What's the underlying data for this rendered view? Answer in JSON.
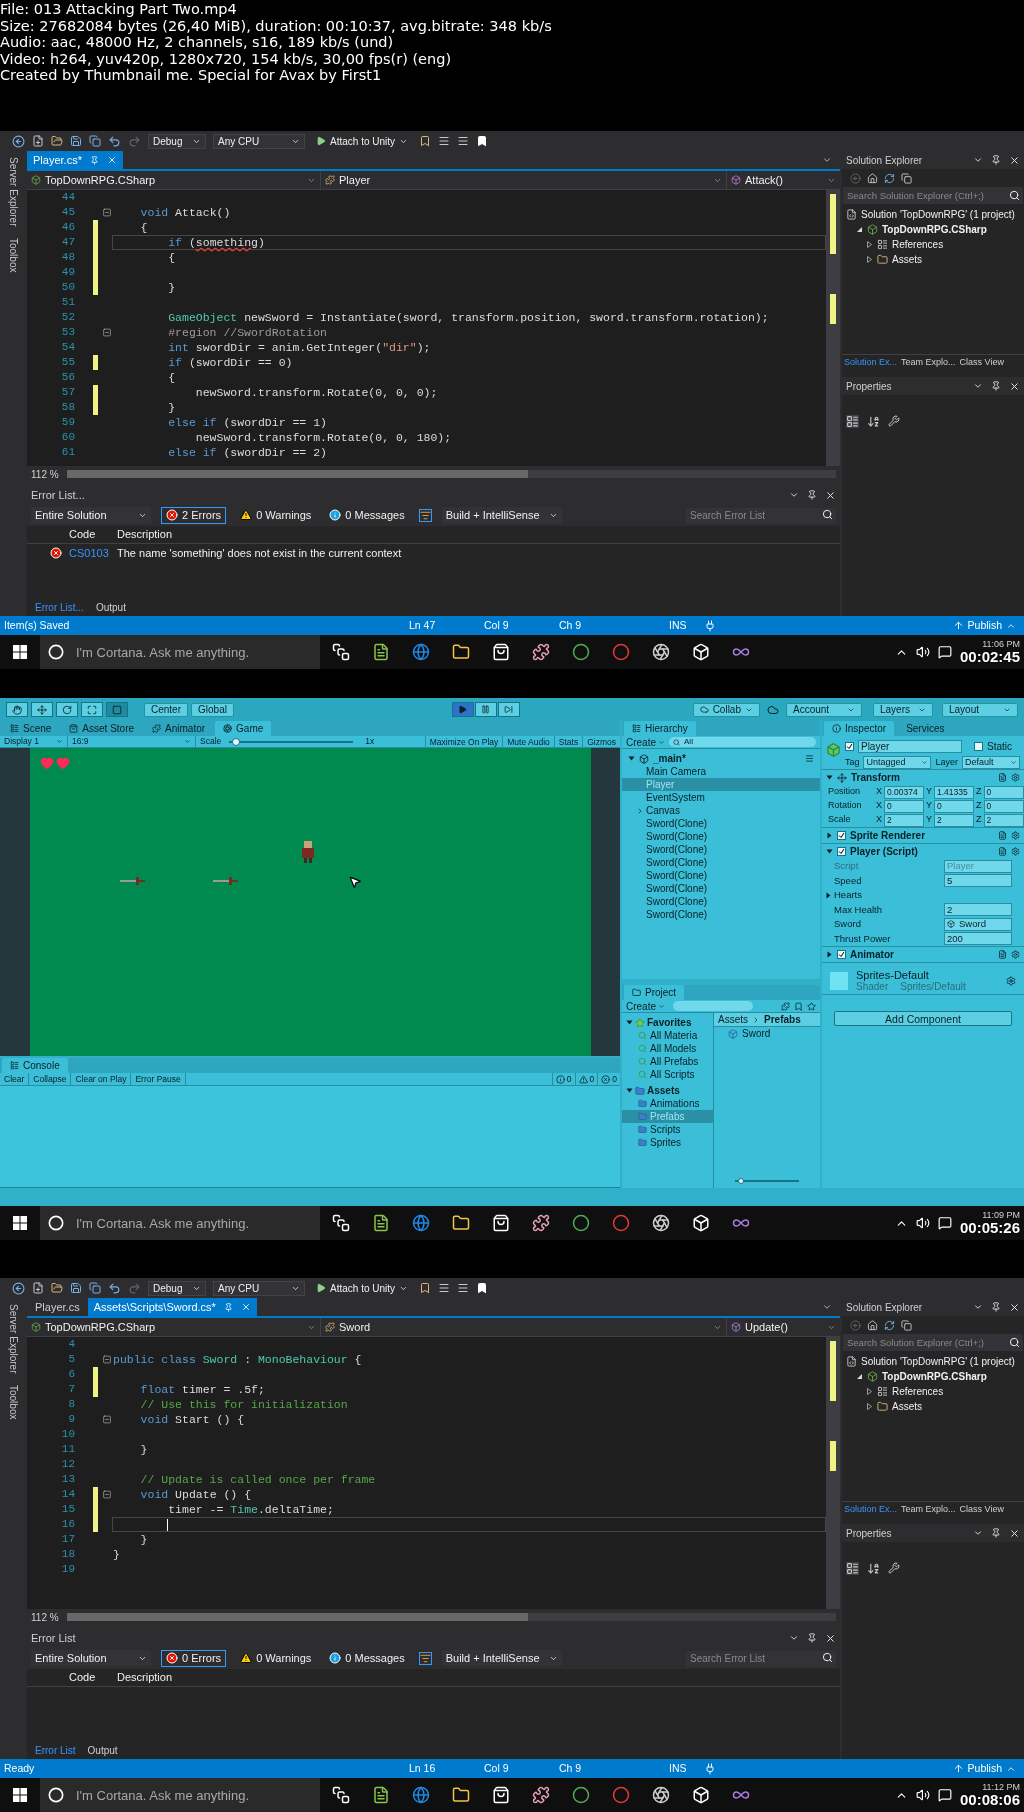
{
  "file_info": [
    "File: 013 Attacking Part Two.mp4",
    "Size: 27682084 bytes (26,40 MiB), duration: 00:10:37, avg.bitrate: 348 kb/s",
    "Audio: aac, 48000 Hz, 2 channels, s16, 189 kb/s (und)",
    "Video: h264, yuv420p, 1280x720, 154 kb/s, 30,00 fps(r) (eng)",
    "Created by Thumbnail me. Special for Avax by First1"
  ],
  "frames": [
    {
      "kind": "visual_studio",
      "toolbar": {
        "configuration": "Debug",
        "platform": "Any CPU",
        "run": "Attach to Unity"
      },
      "side_tabs": [
        "Server Explorer",
        "Toolbox"
      ],
      "tabs": [
        {
          "label": "Player.cs*",
          "selected": true
        }
      ],
      "navigation": [
        "TopDownRPG.CSharp",
        "Player",
        "Attack()"
      ],
      "lines": [
        {
          "number": "44",
          "changed": false,
          "current": false,
          "foldable": false
        },
        {
          "number": "45",
          "changed": false,
          "current": false,
          "foldable": true,
          "parts": [
            {
              "text": "    void",
              "kind": "keyword"
            },
            {
              "text": " Attack()",
              "kind": "plain"
            }
          ]
        },
        {
          "number": "46",
          "changed": true,
          "current": false,
          "foldable": false,
          "parts": [
            {
              "text": "    {",
              "kind": "plain"
            }
          ]
        },
        {
          "number": "47",
          "changed": true,
          "current": true,
          "foldable": false,
          "parts": [
            {
              "text": "        if",
              "kind": "keyword"
            },
            {
              "text": " (",
              "kind": "plain"
            },
            {
              "text": "something",
              "kind": "error"
            },
            {
              "text": ")",
              "kind": "plain"
            }
          ]
        },
        {
          "number": "48",
          "changed": true,
          "current": false,
          "foldable": false,
          "parts": [
            {
              "text": "        {",
              "kind": "plain"
            }
          ]
        },
        {
          "number": "49",
          "changed": true,
          "current": false,
          "foldable": false
        },
        {
          "number": "50",
          "changed": true,
          "current": false,
          "foldable": false,
          "parts": [
            {
              "text": "        }",
              "kind": "plain"
            }
          ]
        },
        {
          "number": "51",
          "changed": false,
          "current": false,
          "foldable": false
        },
        {
          "number": "52",
          "changed": false,
          "current": false,
          "foldable": false,
          "parts": [
            {
              "text": "        GameObject",
              "kind": "type"
            },
            {
              "text": " newSword = Instantiate(sword, transform.position, sword.transform.rotation);",
              "kind": "plain"
            }
          ]
        },
        {
          "number": "53",
          "changed": false,
          "current": false,
          "foldable": true,
          "parts": [
            {
              "text": "        #region //SwordRotation",
              "kind": "preprocessor"
            }
          ]
        },
        {
          "number": "54",
          "changed": false,
          "current": false,
          "foldable": false,
          "parts": [
            {
              "text": "        int",
              "kind": "keyword"
            },
            {
              "text": " swordDir = anim.GetInteger(",
              "kind": "plain"
            },
            {
              "text": "\"dir\"",
              "kind": "string"
            },
            {
              "text": ");",
              "kind": "plain"
            }
          ]
        },
        {
          "number": "55",
          "changed": true,
          "current": false,
          "foldable": false,
          "parts": [
            {
              "text": "        if",
              "kind": "keyword"
            },
            {
              "text": " (swordDir == 0)",
              "kind": "plain"
            }
          ]
        },
        {
          "number": "56",
          "changed": false,
          "current": false,
          "foldable": false,
          "parts": [
            {
              "text": "        {",
              "kind": "plain"
            }
          ]
        },
        {
          "number": "57",
          "changed": true,
          "current": false,
          "foldable": false,
          "parts": [
            {
              "text": "            newSword.transform.Rotate(0, 0, 0);",
              "kind": "plain"
            }
          ]
        },
        {
          "number": "58",
          "changed": true,
          "current": false,
          "foldable": false,
          "parts": [
            {
              "text": "        }",
              "kind": "plain"
            }
          ]
        },
        {
          "number": "59",
          "changed": false,
          "current": false,
          "foldable": false,
          "parts": [
            {
              "text": "        else if",
              "kind": "keyword"
            },
            {
              "text": " (swordDir == 1)",
              "kind": "plain"
            }
          ]
        },
        {
          "number": "60",
          "changed": false,
          "current": false,
          "foldable": false,
          "parts": [
            {
              "text": "            newSword.transform.Rotate(0, 0, 180);",
              "kind": "plain"
            }
          ]
        },
        {
          "number": "61",
          "changed": false,
          "current": false,
          "foldable": false,
          "parts": [
            {
              "text": "        else if",
              "kind": "keyword"
            },
            {
              "text": " (swordDir == 2)",
              "kind": "plain"
            }
          ]
        }
      ],
      "zoom": "112 %",
      "error_list": {
        "title": "Error List...",
        "scope": "Entire Solution",
        "errors": "2 Errors",
        "warnings": "0 Warnings",
        "messages": "0 Messages",
        "filter": "Build + IntelliSense",
        "search_placeholder": "Search Error List",
        "columns": [
          "Code",
          "Description"
        ],
        "rows": [
          {
            "code": "CS0103",
            "description": "The name 'something' does not exist in the current context"
          }
        ],
        "tabs": [
          {
            "label": "Error List...",
            "selected": true
          },
          {
            "label": "Output",
            "selected": false
          }
        ]
      },
      "solution_explorer": {
        "title": "Solution Explorer",
        "search_placeholder": "Search Solution Explorer (Ctrl+;)",
        "tree": [
          {
            "label": "Solution 'TopDownRPG' (1 project)",
            "kind": "solution",
            "children": [
              {
                "label": "TopDownRPG.CSharp",
                "kind": "project",
                "expanded": true,
                "children": [
                  {
                    "label": "References",
                    "kind": "references",
                    "expanded": false
                  },
                  {
                    "label": "Assets",
                    "kind": "folder",
                    "expanded": false
                  }
                ]
              }
            ]
          }
        ],
        "tabs": [
          {
            "label": "Solution Ex...",
            "selected": true
          },
          {
            "label": "Team Explo...",
            "selected": false
          },
          {
            "label": "Class View",
            "selected": false
          }
        ]
      },
      "properties": {
        "title": "Properties"
      },
      "status_bar": {
        "message": "Item(s) Saved",
        "line": "Ln 47",
        "column": "Col 9",
        "char": "Ch 9",
        "mode": "INS",
        "publish": "Publish"
      },
      "taskbar": {
        "search_placeholder": "I'm Cortana. Ask me anything.",
        "clock": "11:06 PM"
      },
      "timestamp": "00:02:45"
    },
    {
      "kind": "unity",
      "toolbar": {
        "pivot": "Center",
        "space": "Global",
        "collab": "Collab",
        "account": "Account",
        "layers": "Layers",
        "layout": "Layout",
        "playing": true
      },
      "view_tabs": [
        {
          "label": "Scene",
          "selected": false
        },
        {
          "label": "Asset Store",
          "selected": false
        },
        {
          "label": "Animator",
          "selected": false
        },
        {
          "label": "Game",
          "selected": true
        }
      ],
      "game_toolbar": {
        "display": "Display 1",
        "aspect": "16:9",
        "scale_label": "Scale",
        "scale": {
          "level": 0.02
        },
        "scale_value": "1x",
        "buttons": [
          "Maximize On Play",
          "Mute Audio",
          "Stats",
          "Gizmos"
        ]
      },
      "console": {
        "title": "Console",
        "buttons": [
          "Clear",
          "Collapse",
          "Clear on Play",
          "Error Pause"
        ],
        "counts": [
          "0",
          "0",
          "0"
        ]
      },
      "hierarchy": {
        "title": "Hierarchy",
        "create": "Create",
        "search": "All",
        "scene": "_main*",
        "items": [
          {
            "label": "Main Camera",
            "selected": false,
            "expandable": false
          },
          {
            "label": "Player",
            "selected": true,
            "expandable": false
          },
          {
            "label": "EventSystem",
            "selected": false,
            "expandable": false
          },
          {
            "label": "Canvas",
            "selected": false,
            "expandable": true
          },
          {
            "label": "Sword(Clone)",
            "selected": false,
            "expandable": false
          },
          {
            "label": "Sword(Clone)",
            "selected": false,
            "expandable": false
          },
          {
            "label": "Sword(Clone)",
            "selected": false,
            "expandable": false
          },
          {
            "label": "Sword(Clone)",
            "selected": false,
            "expandable": false
          },
          {
            "label": "Sword(Clone)",
            "selected": false,
            "expandable": false
          },
          {
            "label": "Sword(Clone)",
            "selected": false,
            "expandable": false
          },
          {
            "label": "Sword(Clone)",
            "selected": false,
            "expandable": false
          },
          {
            "label": "Sword(Clone)",
            "selected": false,
            "expandable": false
          }
        ]
      },
      "project": {
        "title": "Project",
        "create": "Create",
        "tree": [
          {
            "label": "Favorites",
            "kind": "favorites",
            "expanded": true,
            "selected": false,
            "children": [
              {
                "label": "All Materia",
                "kind": "search",
                "selected": false
              },
              {
                "label": "All Models",
                "kind": "search",
                "selected": false
              },
              {
                "label": "All Prefabs",
                "kind": "search",
                "selected": false
              },
              {
                "label": "All Scripts",
                "kind": "search",
                "selected": false
              }
            ]
          },
          {
            "label": "Assets",
            "kind": "folder",
            "expanded": true,
            "selected": false,
            "children": [
              {
                "label": "Animations",
                "kind": "folder",
                "selected": false
              },
              {
                "label": "Prefabs",
                "kind": "folder",
                "selected": true
              },
              {
                "label": "Scripts",
                "kind": "folder",
                "selected": false
              },
              {
                "label": "Sprites",
                "kind": "folder",
                "selected": false
              }
            ]
          }
        ],
        "path": [
          "Assets",
          "Prefabs"
        ],
        "files": [
          "Sword"
        ],
        "icon_size": {
          "level": 0.05
        }
      },
      "inspector": {
        "tabs": [
          {
            "label": "Inspector",
            "selected": true
          },
          {
            "label": "Services",
            "selected": false
          }
        ],
        "name": "Player",
        "active": true,
        "static_label": "Static",
        "static": false,
        "tag_label": "Tag",
        "tag": "Untagged",
        "layer_label": "Layer",
        "layer": "Default",
        "components": [
          {
            "kind": "transform",
            "title": "Transform",
            "expanded": true,
            "rows": [
              {
                "label": "Position",
                "values": [
                  {
                    "axis": "X",
                    "value": "0.00374"
                  },
                  {
                    "axis": "Y",
                    "value": "1.41335"
                  },
                  {
                    "axis": "Z",
                    "value": "0"
                  }
                ]
              },
              {
                "label": "Rotation",
                "values": [
                  {
                    "axis": "X",
                    "value": "0"
                  },
                  {
                    "axis": "Y",
                    "value": "0"
                  },
                  {
                    "axis": "Z",
                    "value": "0"
                  }
                ]
              },
              {
                "label": "Scale",
                "values": [
                  {
                    "axis": "X",
                    "value": "2"
                  },
                  {
                    "axis": "Y",
                    "value": "2"
                  },
                  {
                    "axis": "Z",
                    "value": "2"
                  }
                ]
              }
            ]
          },
          {
            "kind": "component",
            "title": "Sprite Renderer",
            "expanded": false,
            "enabled": true
          },
          {
            "kind": "component",
            "title": "Player (Script)",
            "expanded": true,
            "enabled": true,
            "fields": [
              {
                "kind": "script",
                "label": "Script",
                "value": "Player"
              },
              {
                "kind": "value",
                "label": "Speed",
                "value": "5"
              },
              {
                "kind": "foldout",
                "label": "Hearts"
              },
              {
                "kind": "value",
                "label": "Max Health",
                "value": "2"
              },
              {
                "kind": "object",
                "label": "Sword",
                "value": "Sword"
              },
              {
                "kind": "value",
                "label": "Thrust Power",
                "value": "200"
              }
            ]
          },
          {
            "kind": "component",
            "title": "Animator",
            "expanded": false,
            "enabled": true
          },
          {
            "kind": "material",
            "title": "Sprites-Default",
            "shader_label": "Shader",
            "shader": "Sprites/Default"
          }
        ],
        "add_component": "Add Component"
      },
      "taskbar": {
        "search_placeholder": "I'm Cortana. Ask me anything.",
        "clock": "11:09 PM"
      },
      "timestamp": "00:05:26"
    },
    {
      "kind": "visual_studio",
      "toolbar": {
        "configuration": "Debug",
        "platform": "Any CPU",
        "run": "Attach to Unity"
      },
      "side_tabs": [
        "Server Explorer",
        "Toolbox"
      ],
      "tabs": [
        {
          "label": "Player.cs",
          "selected": false
        },
        {
          "label": "Assets\\Scripts\\Sword.cs*",
          "selected": true
        }
      ],
      "navigation": [
        "TopDownRPG.CSharp",
        "Sword",
        "Update()"
      ],
      "lines": [
        {
          "number": "4",
          "changed": false,
          "current": false,
          "foldable": false
        },
        {
          "number": "5",
          "changed": false,
          "current": false,
          "foldable": true,
          "parts": [
            {
              "text": "public class ",
              "kind": "keyword"
            },
            {
              "text": "Sword",
              "kind": "type"
            },
            {
              "text": " : ",
              "kind": "plain"
            },
            {
              "text": "MonoBehaviour",
              "kind": "type"
            },
            {
              "text": " {",
              "kind": "plain"
            }
          ]
        },
        {
          "number": "6",
          "changed": true,
          "current": false,
          "foldable": false
        },
        {
          "number": "7",
          "changed": true,
          "current": false,
          "foldable": false,
          "parts": [
            {
              "text": "    float",
              "kind": "keyword"
            },
            {
              "text": " timer = .5f;",
              "kind": "plain"
            }
          ]
        },
        {
          "number": "8",
          "changed": false,
          "current": false,
          "foldable": false,
          "parts": [
            {
              "text": "    // Use this for initialization",
              "kind": "comment"
            }
          ]
        },
        {
          "number": "9",
          "changed": false,
          "current": false,
          "foldable": true,
          "parts": [
            {
              "text": "    void",
              "kind": "keyword"
            },
            {
              "text": " Start () {",
              "kind": "plain"
            }
          ]
        },
        {
          "number": "10",
          "changed": false,
          "current": false,
          "foldable": false
        },
        {
          "number": "11",
          "changed": false,
          "current": false,
          "foldable": false,
          "parts": [
            {
              "text": "    }",
              "kind": "plain"
            }
          ]
        },
        {
          "number": "12",
          "changed": false,
          "current": false,
          "foldable": false
        },
        {
          "number": "13",
          "changed": false,
          "current": false,
          "foldable": false,
          "parts": [
            {
              "text": "    // Update is called once per frame",
              "kind": "comment"
            }
          ]
        },
        {
          "number": "14",
          "changed": true,
          "current": false,
          "foldable": true,
          "parts": [
            {
              "text": "    void",
              "kind": "keyword"
            },
            {
              "text": " Update () {",
              "kind": "plain"
            }
          ]
        },
        {
          "number": "15",
          "changed": true,
          "current": false,
          "foldable": false,
          "parts": [
            {
              "text": "        timer -= ",
              "kind": "plain"
            },
            {
              "text": "Time",
              "kind": "type"
            },
            {
              "text": ".deltaTime;",
              "kind": "plain"
            }
          ]
        },
        {
          "number": "16",
          "changed": true,
          "current": true,
          "foldable": false
        },
        {
          "number": "17",
          "changed": false,
          "current": false,
          "foldable": false,
          "parts": [
            {
              "text": "    }",
              "kind": "plain"
            }
          ]
        },
        {
          "number": "18",
          "changed": false,
          "current": false,
          "foldable": false,
          "parts": [
            {
              "text": "}",
              "kind": "plain"
            }
          ]
        },
        {
          "number": "19",
          "changed": false,
          "current": false,
          "foldable": false
        }
      ],
      "zoom": "112 %",
      "error_list": {
        "title": "Error List",
        "scope": "Entire Solution",
        "errors": "0 Errors",
        "warnings": "0 Warnings",
        "messages": "0 Messages",
        "filter": "Build + IntelliSense",
        "search_placeholder": "Search Error List",
        "columns": [
          "Code",
          "Description"
        ],
        "tabs": [
          {
            "label": "Error List",
            "selected": true
          },
          {
            "label": "Output",
            "selected": false
          }
        ]
      },
      "solution_explorer": {
        "title": "Solution Explorer",
        "search_placeholder": "Search Solution Explorer (Ctrl+;)",
        "tree": [
          {
            "label": "Solution 'TopDownRPG' (1 project)",
            "kind": "solution",
            "children": [
              {
                "label": "TopDownRPG.CSharp",
                "kind": "project",
                "expanded": true,
                "children": [
                  {
                    "label": "References",
                    "kind": "references",
                    "expanded": false
                  },
                  {
                    "label": "Assets",
                    "kind": "folder",
                    "expanded": false
                  }
                ]
              }
            ]
          }
        ],
        "tabs": [
          {
            "label": "Solution Ex...",
            "selected": true
          },
          {
            "label": "Team Explo...",
            "selected": false
          },
          {
            "label": "Class View",
            "selected": false
          }
        ]
      },
      "properties": {
        "title": "Properties"
      },
      "status_bar": {
        "message": "Ready",
        "line": "Ln 16",
        "column": "Col 9",
        "char": "Ch 9",
        "mode": "INS",
        "publish": "Publish"
      },
      "taskbar": {
        "search_placeholder": "I'm Cortana. Ask me anything.",
        "clock": "11:12 PM"
      },
      "timestamp": "00:08:06"
    }
  ]
}
